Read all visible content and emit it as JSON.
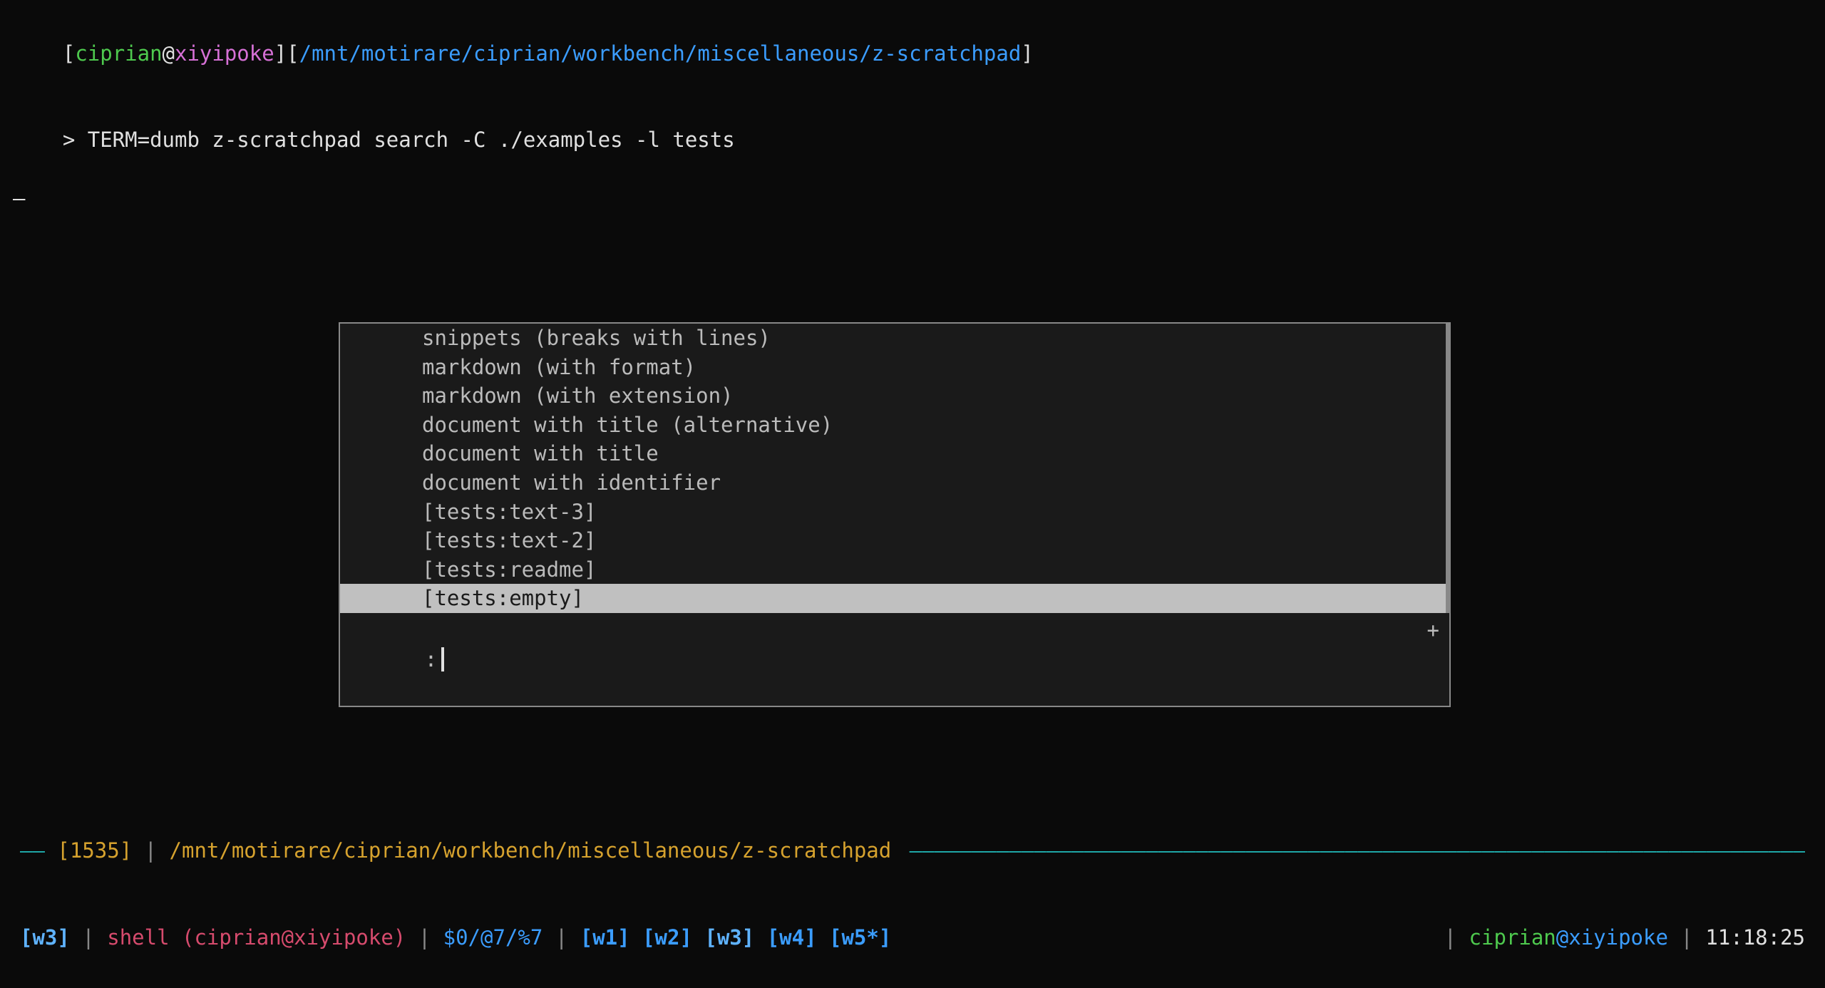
{
  "prompt": {
    "open1": "[",
    "user": "ciprian",
    "at": "@",
    "host": "xiyipoke",
    "close1": "]",
    "open2": "[",
    "path": "/mnt/motirare/ciprian/workbench/miscellaneous/z-scratchpad",
    "close2": "]",
    "indicator": "> ",
    "command": "TERM=dumb z-scratchpad search -C ./examples -l tests",
    "cursor_char": "–"
  },
  "popup": {
    "items": [
      "snippets (breaks with lines)",
      "markdown (with format)",
      "markdown (with extension)",
      "document with title (alternative)",
      "document with title",
      "document with identifier",
      "[tests:text-3]",
      "[tests:text-2]",
      "[tests:readme]",
      "[tests:empty]"
    ],
    "selected_index": 9,
    "input_prefix": ":",
    "plus": "+"
  },
  "status1": {
    "lead": "—— ",
    "num": "[1535]",
    "sep1": " | ",
    "path": "/mnt/motirare/ciprian/workbench/miscellaneous/z-scratchpad",
    "fill": " ——————————————————————————————————————————————————————————————————————————————————————————————————————————————————————————————————————————"
  },
  "status2": {
    "w_left": "[w3]",
    "sep1": " | ",
    "shell": "shell ",
    "shell_paren": "(ciprian@xiyipoke)",
    "sep2": " | ",
    "counts": "$0/@7/%7",
    "sep3": " | ",
    "w1": "[w1]",
    "w2": "[w2]",
    "w3": "[w3]",
    "w4": "[w4]",
    "w5": "[w5*]",
    "sep_r1": "| ",
    "user_r": "ciprian",
    "at_r": "@",
    "host_r": "xiyipoke",
    "sep_r2": " | ",
    "time": "11:18:25"
  }
}
